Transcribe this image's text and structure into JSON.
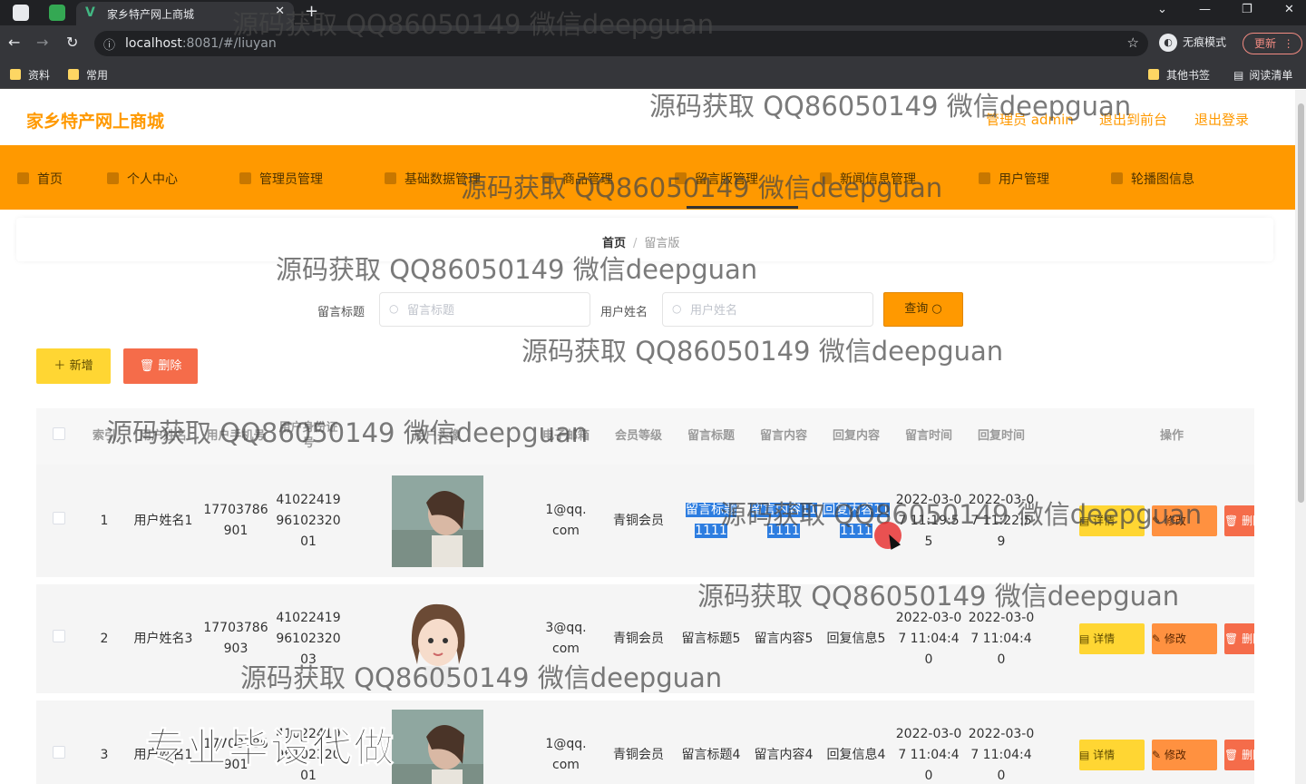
{
  "browser": {
    "tab_title": "家乡特产网上商城",
    "tab_favicon": "V",
    "url_host": "localhost",
    "url_rest": ":8081/#/liuyan",
    "incognito_label": "无痕模式",
    "update_label": "更新",
    "bookmarks": [
      "资料",
      "常用"
    ],
    "bookmarks_right": [
      "其他书签",
      "阅读清单"
    ]
  },
  "header": {
    "site_title": "家乡特产网上商城",
    "admin_label": "管理员 admin",
    "to_front_label": "退出到前台",
    "logout_label": "退出登录"
  },
  "nav": {
    "items": [
      "首页",
      "个人中心",
      "管理员管理",
      "基础数据管理",
      "商品管理",
      "留言版管理",
      "新闻信息管理",
      "用户管理",
      "轮播图信息"
    ],
    "active_index": 5,
    "accent": "#ff9900"
  },
  "breadcrumb": {
    "home": "首页",
    "separator": "/",
    "current": "留言版"
  },
  "search": {
    "title_label": "留言标题",
    "title_placeholder": "留言标题",
    "user_label": "用户姓名",
    "user_placeholder": "用户姓名",
    "query_label": "查询",
    "add_label": "新增",
    "delete_label": "删除"
  },
  "table": {
    "headers": [
      "索引",
      "用户姓名",
      "用户手机号",
      "用户身份证号",
      "用户头像",
      "电子邮箱",
      "会员等级",
      "留言标题",
      "留言内容",
      "回复内容",
      "留言时间",
      "回复时间",
      "操作"
    ],
    "actions": {
      "detail": "详情",
      "edit": "修改",
      "delete": "删除"
    },
    "rows": [
      {
        "index": "1",
        "name": "用户姓名1",
        "phone": "17703786901",
        "id_card": "410224199610232001",
        "avatar": "avatar-photo-girl",
        "email": "1@qq.com",
        "level": "青铜会员",
        "title": "留言标题1111",
        "content": "留言内容111111",
        "reply": "回复内容111111",
        "created": "2022-03-07 11:19:55",
        "replied": "2022-03-07 11:22:59"
      },
      {
        "index": "2",
        "name": "用户姓名3",
        "phone": "17703786903",
        "id_card": "410224199610232003",
        "avatar": "avatar-cartoon-girl",
        "email": "3@qq.com",
        "level": "青铜会员",
        "title": "留言标题5",
        "content": "留言内容5",
        "reply": "回复信息5",
        "created": "2022-03-07 11:04:40",
        "replied": "2022-03-07 11:04:40"
      },
      {
        "index": "3",
        "name": "用户姓名1",
        "phone": "17703786901",
        "id_card": "410224199610232001",
        "avatar": "avatar-photo-girl",
        "email": "1@qq.com",
        "level": "青铜会员",
        "title": "留言标题4",
        "content": "留言内容4",
        "reply": "回复信息4",
        "created": "2022-03-07 11:04:40",
        "replied": "2022-03-07 11:04:40"
      }
    ]
  },
  "watermark": "源码获取 QQ86050149 微信deepguan",
  "stamp": "专业毕设代做"
}
